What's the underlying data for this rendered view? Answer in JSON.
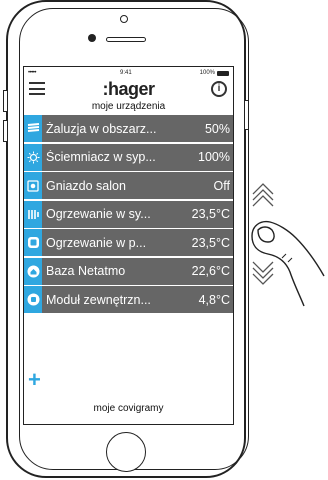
{
  "status": {
    "signal": "•••••",
    "time": "9:41",
    "battery": "100%"
  },
  "app": {
    "logo": ":hager",
    "info": "i"
  },
  "sections": {
    "devices_title": "moje urządzenia",
    "scenes_title": "moje covigramy"
  },
  "devices": [
    {
      "icon": "shutter-icon",
      "name": "Żaluzja w obszarz...",
      "value": "50%"
    },
    {
      "icon": "dimmer-icon",
      "name": "Ściemniacz w syp...",
      "value": "100%"
    },
    {
      "icon": "socket-icon",
      "name": "Gniazdo salon",
      "value": "Off"
    },
    {
      "icon": "radiator-icon",
      "name": "Ogrzewanie w sy...",
      "value": "23,5°C"
    },
    {
      "icon": "thermostat-icon",
      "name": "Ogrzewanie w p...",
      "value": "23,5°C"
    },
    {
      "icon": "home-station-icon",
      "name": "Baza Netatmo",
      "value": "22,6°C"
    },
    {
      "icon": "outdoor-module-icon",
      "name": "Moduł zewnętrzn...",
      "value": "4,8°C"
    }
  ],
  "add_label": "+",
  "colors": {
    "accent": "#2fa7e0",
    "row_bg": "#666666"
  }
}
